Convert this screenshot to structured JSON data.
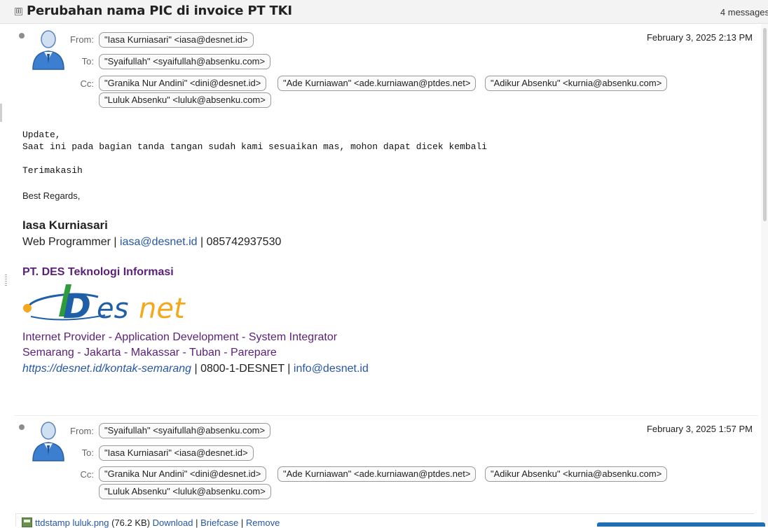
{
  "thread": {
    "title": "Perubahan nama PIC di invoice PT TKI",
    "count": "4 messages",
    "toggle": "⊞"
  },
  "message1": {
    "from_label": "From:",
    "to_label": "To:",
    "cc_label": "Cc:",
    "from": "\"Iasa Kurniasari\" <iasa@desnet.id>",
    "to": "\"Syaifullah\" <syaifullah@absenku.com>",
    "cc": [
      "\"Granika Nur Andini\" <dini@desnet.id>",
      "\"Ade Kurniawan\" <ade.kurniawan@ptdes.net>",
      "\"Adikur Absenku\" <kurnia@absenku.com>",
      "\"Luluk Absenku\" <luluk@absenku.com>"
    ],
    "date": "February 3, 2025 2:13 PM",
    "body_line1": "Update,",
    "body_line2": "Saat ini pada bagian tanda tangan sudah kami sesuaikan mas, mohon dapat dicek kembali",
    "body_line3": "Terimakasih",
    "regards": "Best Regards,",
    "signature": {
      "name": "Iasa Kurniasari",
      "role": "Web Programmer | ",
      "email": "iasa@desnet.id",
      "phone": " | 085742937530",
      "company": "PT. DES Teknologi Informasi",
      "logo_text": "Desnet",
      "services": "Internet Provider - Application Development - System Integrator",
      "cities": "Semarang - Jakarta - Makassar - Tuban - Parepare",
      "url": "https://desnet.id/kontak-semarang",
      "hotline": " | 0800-1-DESNET | ",
      "info_email": "info@desnet.id"
    }
  },
  "message2": {
    "from_label": "From:",
    "to_label": "To:",
    "cc_label": "Cc:",
    "from": "\"Syaifullah\" <syaifullah@absenku.com>",
    "to": "\"Iasa Kurniasari\" <iasa@desnet.id>",
    "cc": [
      "\"Granika Nur Andini\" <dini@desnet.id>",
      "\"Ade Kurniawan\" <ade.kurniawan@ptdes.net>",
      "\"Adikur Absenku\" <kurnia@absenku.com>",
      "\"Luluk Absenku\" <luluk@absenku.com>"
    ],
    "date": "February 3, 2025 1:57 PM",
    "attachment": {
      "filename": "ttdstamp luluk.png",
      "size": " (76.2 KB) ",
      "download": "Download",
      "briefcase": "Briefcase",
      "remove": "Remove",
      "sep": " | "
    }
  },
  "colors": {
    "link": "#2656a6",
    "purple": "#5a1f78",
    "logo_blue": "#1f5fa8",
    "logo_green": "#2e9c3a",
    "logo_orange": "#f4a81c"
  }
}
